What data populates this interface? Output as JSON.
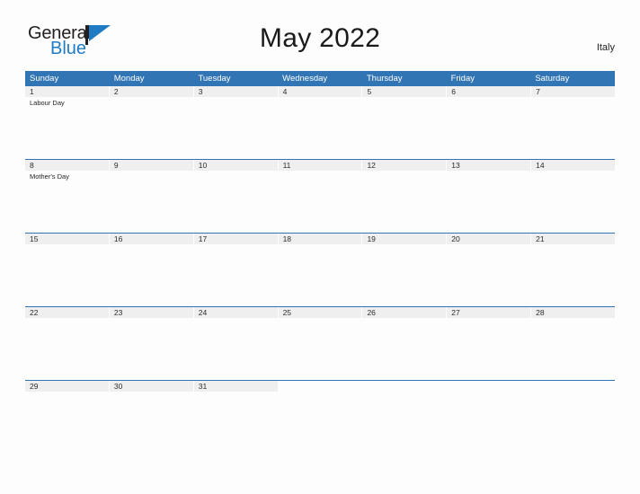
{
  "header": {
    "logo": {
      "text_primary": "General",
      "text_secondary": "Blue",
      "icon": "flag-triangle-icon",
      "color_primary": "#231F20",
      "color_secondary": "#1F7BC4"
    },
    "title": "May 2022",
    "country": "Italy"
  },
  "calendar": {
    "accent_color": "#3275B5",
    "date_band_color": "#EFEFEF",
    "weekdays": [
      "Sunday",
      "Monday",
      "Tuesday",
      "Wednesday",
      "Thursday",
      "Friday",
      "Saturday"
    ],
    "weeks": [
      {
        "days": [
          {
            "date": "1",
            "events": [
              "Labour Day"
            ]
          },
          {
            "date": "2",
            "events": []
          },
          {
            "date": "3",
            "events": []
          },
          {
            "date": "4",
            "events": []
          },
          {
            "date": "5",
            "events": []
          },
          {
            "date": "6",
            "events": []
          },
          {
            "date": "7",
            "events": []
          }
        ]
      },
      {
        "days": [
          {
            "date": "8",
            "events": [
              "Mother's Day"
            ]
          },
          {
            "date": "9",
            "events": []
          },
          {
            "date": "10",
            "events": []
          },
          {
            "date": "11",
            "events": []
          },
          {
            "date": "12",
            "events": []
          },
          {
            "date": "13",
            "events": []
          },
          {
            "date": "14",
            "events": []
          }
        ]
      },
      {
        "days": [
          {
            "date": "15",
            "events": []
          },
          {
            "date": "16",
            "events": []
          },
          {
            "date": "17",
            "events": []
          },
          {
            "date": "18",
            "events": []
          },
          {
            "date": "19",
            "events": []
          },
          {
            "date": "20",
            "events": []
          },
          {
            "date": "21",
            "events": []
          }
        ]
      },
      {
        "days": [
          {
            "date": "22",
            "events": []
          },
          {
            "date": "23",
            "events": []
          },
          {
            "date": "24",
            "events": []
          },
          {
            "date": "25",
            "events": []
          },
          {
            "date": "26",
            "events": []
          },
          {
            "date": "27",
            "events": []
          },
          {
            "date": "28",
            "events": []
          }
        ]
      },
      {
        "days": [
          {
            "date": "29",
            "events": []
          },
          {
            "date": "30",
            "events": []
          },
          {
            "date": "31",
            "events": []
          },
          {
            "date": "",
            "events": []
          },
          {
            "date": "",
            "events": []
          },
          {
            "date": "",
            "events": []
          },
          {
            "date": "",
            "events": []
          }
        ]
      }
    ]
  }
}
